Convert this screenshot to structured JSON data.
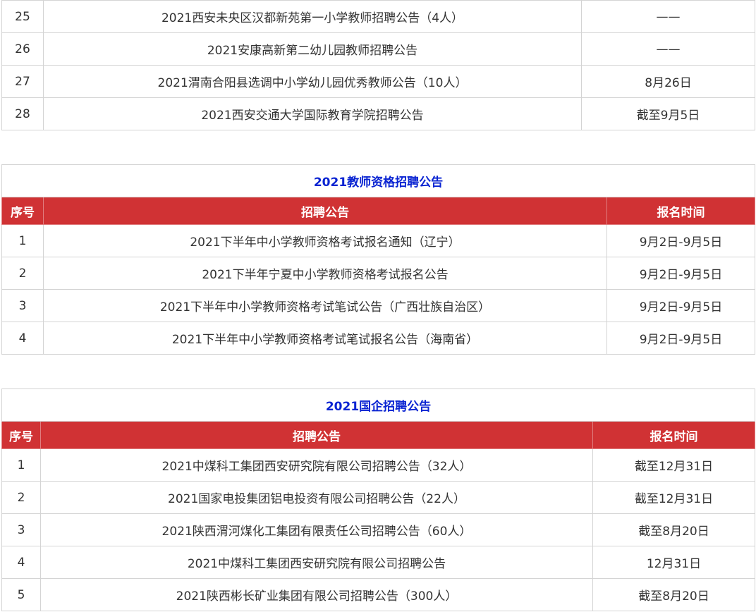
{
  "table1": {
    "rows": [
      {
        "no": "25",
        "title": "2021西安未央区汉都新苑第一小学教师招聘公告（4人）",
        "time": "——"
      },
      {
        "no": "26",
        "title": "2021安康高新第二幼儿园教师招聘公告",
        "time": "——"
      },
      {
        "no": "27",
        "title": "2021渭南合阳县选调中小学幼儿园优秀教师公告（10人）",
        "time": "8月26日"
      },
      {
        "no": "28",
        "title": "2021西安交通大学国际教育学院招聘公告",
        "time": "截至9月5日"
      }
    ]
  },
  "table2": {
    "caption": "2021教师资格招聘公告",
    "headers": {
      "no": "序号",
      "title": "招聘公告",
      "time": "报名时间"
    },
    "rows": [
      {
        "no": "1",
        "title": "2021下半年中小学教师资格考试报名通知（辽宁）",
        "time": "9月2日-9月5日"
      },
      {
        "no": "2",
        "title": "2021下半年宁夏中小学教师资格考试报名公告",
        "time": "9月2日-9月5日"
      },
      {
        "no": "3",
        "title": "2021下半年中小学教师资格考试笔试公告（广西壮族自治区）",
        "time": "9月2日-9月5日"
      },
      {
        "no": "4",
        "title": "2021下半年中小学教师资格考试笔试报名公告（海南省）",
        "time": "9月2日-9月5日"
      }
    ]
  },
  "table3": {
    "caption": "2021国企招聘公告",
    "headers": {
      "no": "序号",
      "title": "招聘公告",
      "time": "报名时间"
    },
    "rows": [
      {
        "no": "1",
        "title": "2021中煤科工集团西安研究院有限公司招聘公告（32人）",
        "time": "截至12月31日"
      },
      {
        "no": "2",
        "title": "2021国家电投集团铝电投资有限公司招聘公告（22人）",
        "time": "截至12月31日"
      },
      {
        "no": "3",
        "title": "2021陕西渭河煤化工集团有限责任公司招聘公告（60人）",
        "time": "截至8月20日"
      },
      {
        "no": "4",
        "title": "2021中煤科工集团西安研究院有限公司招聘公告",
        "time": "12月31日"
      },
      {
        "no": "5",
        "title": "2021陕西彬长矿业集团有限公司招聘公告（300人）",
        "time": "截至8月20日"
      }
    ]
  }
}
